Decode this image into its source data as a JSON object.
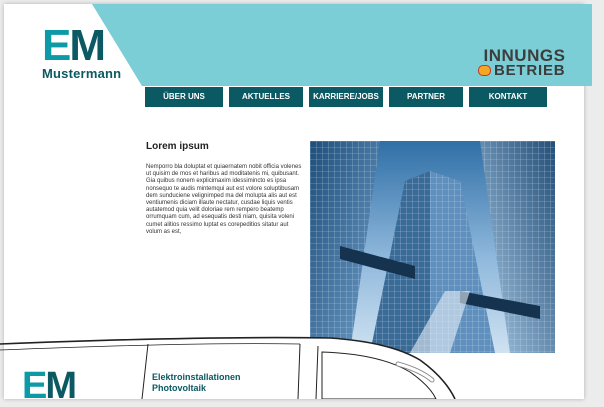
{
  "logo": {
    "letter_e": "E",
    "letter_m": "M",
    "name": "Mustermann"
  },
  "badge": {
    "line1": "INNUNGS",
    "line2": "BETRIEB"
  },
  "nav": {
    "items": [
      {
        "label": "ÜBER UNS"
      },
      {
        "label": "AKTUELLES"
      },
      {
        "label": "KARRIERE/JOBS"
      },
      {
        "label": "PARTNER"
      },
      {
        "label": "KONTAKT"
      }
    ]
  },
  "content": {
    "title": "Lorem ipsum",
    "body": "Nemporro bla doluptat et quiaernatem nobit officia volenes ut quisim de mos et haribus ad moditatenis mi, quibusant. Gia quibus nonem explicimaxim idessimincto es ipsa nonsequo te audis mintemqui aut est volore soluptibusam dem sunduciene velignimped ma del molupta alis aut est ventiumenis diciam illaute nectatur, cusdae liquis ventis autatemod quia velit doloriae rem rempero beatemp orrumquam cum, ad esequatis desti niam, quisita voleni cumet alitios ressimo luptat es corepeditios sitatur aut volum as est,"
  },
  "van": {
    "letter_e": "E",
    "letter_m": "M",
    "service_1": "Elektroinstallationen",
    "service_2": "Photovoltaik"
  },
  "colors": {
    "teal_light": "#7bcdd6",
    "teal": "#0b9aa6",
    "teal_dark": "#0b5963"
  }
}
